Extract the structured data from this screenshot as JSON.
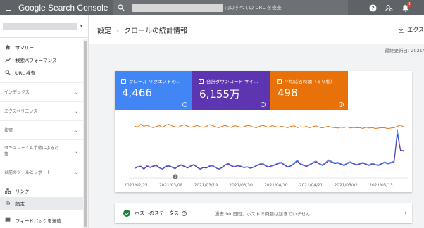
{
  "topbar": {
    "brand_word": "Google",
    "brand_product": "Search Console",
    "search_placeholder": "内のすべての URL を検査",
    "notification_count": "2"
  },
  "sidebar": {
    "dropdown_glyph": "▾",
    "items": [
      {
        "label": "サマリー",
        "icon": "home-icon"
      },
      {
        "label": "検索パフォーマンス",
        "icon": "trending-icon"
      },
      {
        "label": "URL 検査",
        "icon": "search-icon"
      }
    ],
    "sections": [
      {
        "label": "インデックス"
      },
      {
        "label": "エクスペリエンス"
      },
      {
        "label": "拡張"
      },
      {
        "label": "セキュリティと手動による対策"
      },
      {
        "label": "以前のツールとレポート"
      }
    ],
    "bottom_items": [
      {
        "label": "リンク",
        "icon": "links-icon"
      },
      {
        "label": "設定",
        "icon": "gear-icon",
        "active": true
      },
      {
        "label": "フィードバックを送信",
        "icon": "feedback-icon"
      }
    ]
  },
  "header": {
    "breadcrumb_root": "設定",
    "breadcrumb_sep": "›",
    "title": "クロールの統計情報",
    "export_label": "エクス"
  },
  "last_updated": "最終更新日: 2021/",
  "metrics": [
    {
      "label": "クロール リクエストの...",
      "value": "4,466",
      "color": "#4285f4"
    },
    {
      "label": "合計ダウンロード サイ...",
      "value": "6,155万",
      "color": "#5e35b1"
    },
    {
      "label": "平均応答時間（ミリ秒）",
      "value": "498",
      "color": "#e8710a"
    }
  ],
  "chart_data": {
    "type": "line",
    "x_tick_labels": [
      "2021/02/25",
      "2021/03/08",
      "2021/03/19",
      "2021/03/30",
      "2021/04/10",
      "2021/04/21",
      "2021/05/02",
      "2021/05/13"
    ],
    "annotation_marker": "1",
    "series": [
      {
        "color": "#e8710a",
        "values": [
          455,
          445,
          470,
          452,
          462,
          448,
          440,
          452,
          458,
          444,
          462,
          470,
          456,
          448,
          444,
          458,
          466,
          452,
          444,
          450,
          460,
          448,
          444,
          452,
          468,
          458,
          446,
          440,
          452,
          460,
          448,
          444,
          458,
          452,
          444,
          448,
          460,
          456,
          444,
          440,
          452,
          462,
          450,
          444,
          458,
          450,
          444,
          452,
          446,
          440,
          452,
          456,
          440,
          448,
          444,
          452,
          440,
          448,
          456,
          444,
          438,
          446,
          452,
          444,
          440,
          436,
          444,
          440,
          448,
          436,
          442,
          438,
          440,
          432,
          444,
          436,
          440,
          432,
          436,
          440,
          438,
          432,
          436,
          440,
          452,
          462,
          448
        ]
      },
      {
        "color": "#4285f4",
        "values": [
          70,
          80,
          85,
          60,
          90,
          75,
          88,
          95,
          70,
          60,
          85,
          90,
          78,
          65,
          88,
          98,
          84,
          70,
          90,
          100,
          78,
          60,
          75,
          70,
          88,
          92,
          70,
          60,
          75,
          98,
          112,
          90,
          80,
          92,
          86,
          72,
          80,
          68,
          76,
          92,
          104,
          112,
          88,
          80,
          92,
          100,
          116,
          120,
          96,
          80,
          90,
          112,
          140,
          108,
          96,
          86,
          100,
          118,
          132,
          110,
          96,
          116,
          142,
          128,
          114,
          120,
          106,
          94,
          116,
          124,
          110,
          98,
          108,
          120,
          104,
          96,
          112,
          100,
          96,
          110,
          124,
          112,
          120,
          132,
          420,
          240,
          220
        ]
      },
      {
        "color": "#5e35b1",
        "values": [
          62,
          74,
          80,
          56,
          84,
          70,
          82,
          88,
          66,
          56,
          80,
          84,
          72,
          60,
          82,
          92,
          78,
          66,
          84,
          94,
          72,
          56,
          70,
          66,
          82,
          86,
          66,
          56,
          70,
          92,
          104,
          84,
          76,
          86,
          80,
          68,
          76,
          64,
          72,
          86,
          98,
          104,
          82,
          76,
          86,
          94,
          108,
          112,
          90,
          76,
          84,
          104,
          130,
          100,
          90,
          80,
          94,
          110,
          124,
          104,
          90,
          108,
          132,
          120,
          106,
          112,
          100,
          88,
          108,
          116,
          104,
          92,
          102,
          112,
          98,
          90,
          104,
          94,
          90,
          104,
          116,
          104,
          112,
          124,
          380,
          226,
          230
        ]
      }
    ],
    "ylim": [
      0,
      520
    ],
    "grid": false,
    "legend": "none"
  },
  "status": {
    "title": "ホストのステータス",
    "help_glyph": "?",
    "message": "過去 90 日間、ホストで問題は起きていません",
    "arrow": "›"
  }
}
